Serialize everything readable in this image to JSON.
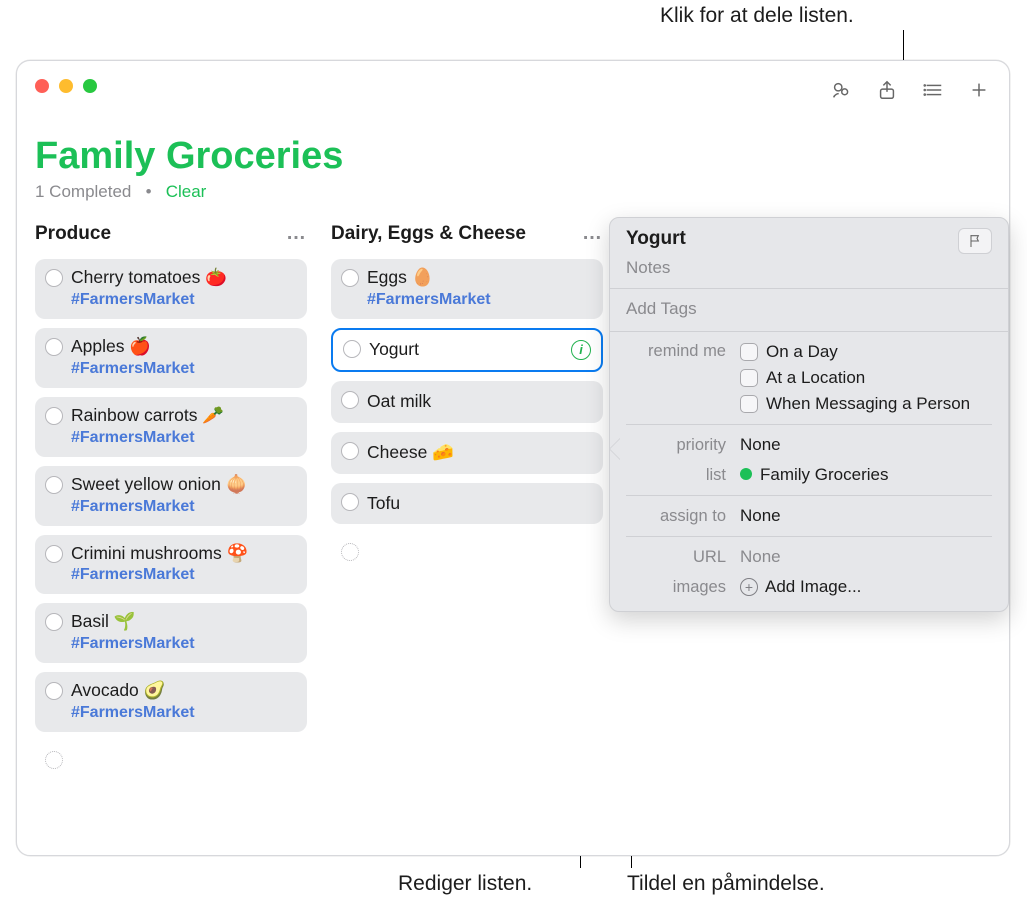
{
  "callouts": {
    "share": "Klik for at dele listen.",
    "editList": "Rediger listen.",
    "assignReminder": "Tildel en påmindelse."
  },
  "window": {
    "title": "Family Groceries",
    "completedText": "1 Completed",
    "separator": "•",
    "clear": "Clear"
  },
  "columns": [
    {
      "header": "Produce",
      "more": "…",
      "items": [
        {
          "name": "Cherry tomatoes 🍅",
          "tag": "#FarmersMarket"
        },
        {
          "name": "Apples 🍎",
          "tag": "#FarmersMarket"
        },
        {
          "name": "Rainbow carrots 🥕",
          "tag": "#FarmersMarket"
        },
        {
          "name": "Sweet yellow onion 🧅",
          "tag": "#FarmersMarket"
        },
        {
          "name": "Crimini mushrooms 🍄",
          "tag": "#FarmersMarket"
        },
        {
          "name": "Basil 🌱",
          "tag": "#FarmersMarket"
        },
        {
          "name": "Avocado 🥑",
          "tag": "#FarmersMarket"
        }
      ]
    },
    {
      "header": "Dairy, Eggs & Cheese",
      "more": "…",
      "items": [
        {
          "name": "Eggs 🥚",
          "tag": "#FarmersMarket"
        },
        {
          "name": "Yogurt",
          "selected": true
        },
        {
          "name": "Oat milk"
        },
        {
          "name": "Cheese 🧀"
        },
        {
          "name": "Tofu"
        }
      ]
    }
  ],
  "popover": {
    "title": "Yogurt",
    "notesPlaceholder": "Notes",
    "addTagsPlaceholder": "Add Tags",
    "remind": {
      "label": "remind me",
      "options": [
        "On a Day",
        "At a Location",
        "When Messaging a Person"
      ]
    },
    "priority": {
      "label": "priority",
      "value": "None"
    },
    "list": {
      "label": "list",
      "value": "Family Groceries",
      "color": "#1cc057"
    },
    "assign": {
      "label": "assign to",
      "value": "None"
    },
    "url": {
      "label": "URL",
      "value": "None"
    },
    "images": {
      "label": "images",
      "value": "Add Image..."
    }
  }
}
